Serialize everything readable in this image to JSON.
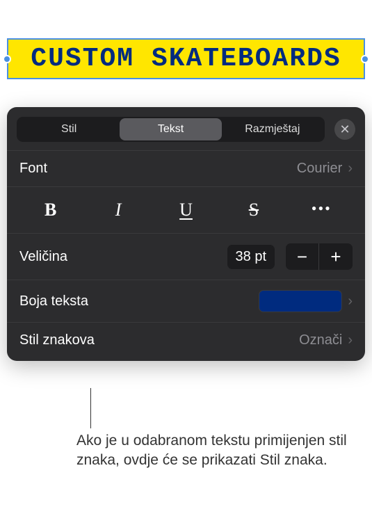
{
  "textbox": {
    "content": "CUSTOM SKATEBOARDS"
  },
  "panel": {
    "tabs": {
      "stil": "Stil",
      "tekst": "Tekst",
      "razmjestaj": "Razmještaj"
    },
    "font": {
      "label": "Font",
      "value": "Courier"
    },
    "format": {
      "bold": "B",
      "italic": "I",
      "underline": "U",
      "strike": "S",
      "more": "•••"
    },
    "size": {
      "label": "Veličina",
      "value": "38 pt",
      "minus": "−",
      "plus": "+"
    },
    "textcolor": {
      "label": "Boja teksta",
      "hex": "#002b7f"
    },
    "charstyle": {
      "label": "Stil znakova",
      "value": "Označi"
    },
    "close": "✕"
  },
  "callout": {
    "text": "Ako je u odabranom tekstu primijenjen stil znaka, ovdje će se prikazati Stil znaka."
  }
}
